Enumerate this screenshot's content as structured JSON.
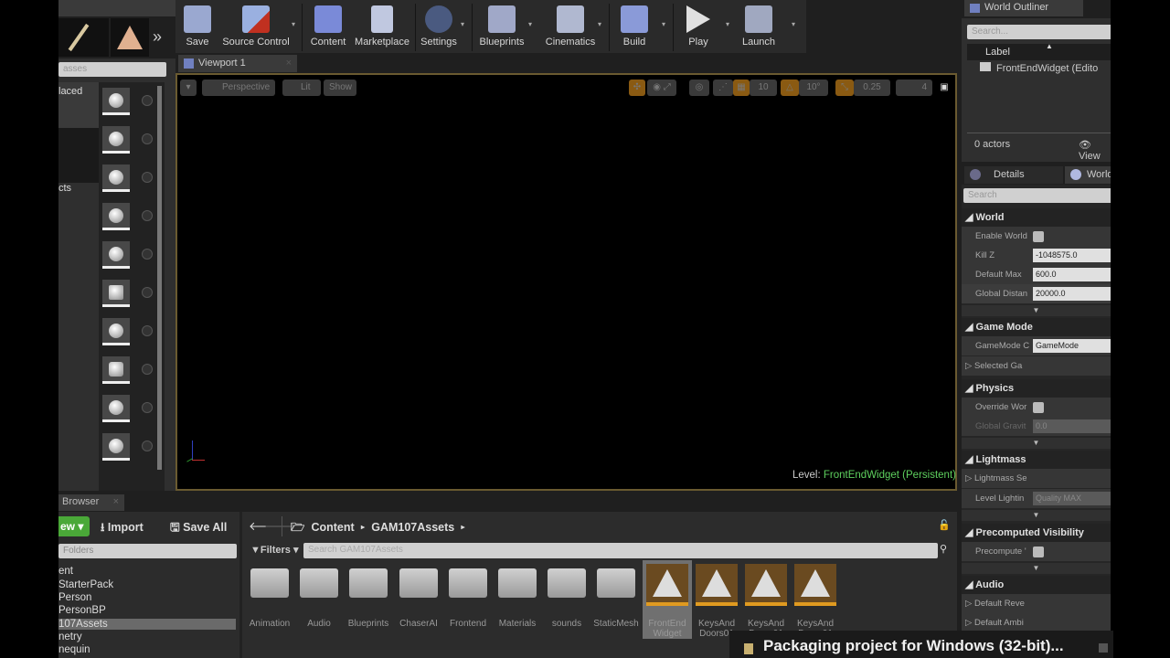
{
  "toolbar": {
    "buttons": [
      {
        "label": "Save",
        "icon": "save-icon"
      },
      {
        "label": "Source Control",
        "icon": "source-control-icon"
      },
      {
        "label": "Content",
        "icon": "content-icon"
      },
      {
        "label": "Marketplace",
        "icon": "marketplace-icon"
      },
      {
        "label": "Settings",
        "icon": "settings-icon"
      },
      {
        "label": "Blueprints",
        "icon": "blueprints-icon"
      },
      {
        "label": "Cinematics",
        "icon": "cinematics-icon"
      },
      {
        "label": "Build",
        "icon": "build-icon"
      },
      {
        "label": "Play",
        "icon": "play-icon"
      },
      {
        "label": "Launch",
        "icon": "launch-icon"
      }
    ],
    "more": "»"
  },
  "modes": {
    "search_placeholder": "asses",
    "categories": [
      "laced",
      "cts"
    ]
  },
  "viewport": {
    "tab": "Viewport 1",
    "view_mode": "Perspective",
    "lighting": "Lit",
    "show": "Show",
    "grid_snap": "10",
    "rot_snap": "10°",
    "scale_snap": "0.25",
    "camera_speed": "4",
    "level_label": "Level:",
    "level_name": "FrontEndWidget (Persistent)"
  },
  "outliner": {
    "title": "World Outliner",
    "search_placeholder": "Search...",
    "col_label": "Label",
    "items": [
      "FrontEndWidget (Edito"
    ],
    "count": "0 actors",
    "view_options": "View"
  },
  "details": {
    "tab1": "Details",
    "tab2": "World",
    "search_placeholder": "Search",
    "sections": {
      "world": {
        "title": "World",
        "enable_world": "Enable World",
        "kill_z": "Kill Z",
        "kill_z_val": "-1048575.0",
        "default_max": "Default Max",
        "default_max_val": "600.0",
        "global_dist": "Global Distan",
        "global_dist_val": "20000.0"
      },
      "game_mode": {
        "title": "Game Mode",
        "gamemode": "GameMode C",
        "gamemode_val": "GameMode",
        "selected": "Selected Ga"
      },
      "physics": {
        "title": "Physics",
        "override": "Override Wor",
        "gravity": "Global Gravit",
        "gravity_val": "0.0"
      },
      "lightmass": {
        "title": "Lightmass",
        "settings": "Lightmass Se",
        "level_lighting": "Level Lightin",
        "level_lighting_val": "Quality MAX"
      },
      "precomputed": {
        "title": "Precomputed Visibility",
        "precompute": "Precompute '"
      },
      "audio": {
        "title": "Audio",
        "reverb": "Default Reve",
        "ambient": "Default Ambi"
      }
    }
  },
  "content_browser": {
    "tab": "Browser",
    "add_new": "ew",
    "import": "Import",
    "save_all": "Save All",
    "folders_placeholder": "Folders",
    "tree": [
      "ent",
      "StarterPack",
      "Person",
      "PersonBP",
      "107Assets",
      "netry",
      "nequin"
    ],
    "path": [
      "Content",
      "GAM107Assets"
    ],
    "filters": "Filters",
    "search_placeholder": "Search GAM107Assets",
    "folders": [
      "Animation",
      "Audio",
      "Blueprints",
      "ChaserAI",
      "Frontend",
      "Materials",
      "sounds",
      "StaticMesh"
    ],
    "assets": [
      "FrontEnd Widget",
      "KeysAnd Doors01",
      "KeysAnd Doors01",
      "KeysAnd Doors01"
    ]
  },
  "notification": {
    "text": "Packaging project for Windows (32-bit)..."
  }
}
